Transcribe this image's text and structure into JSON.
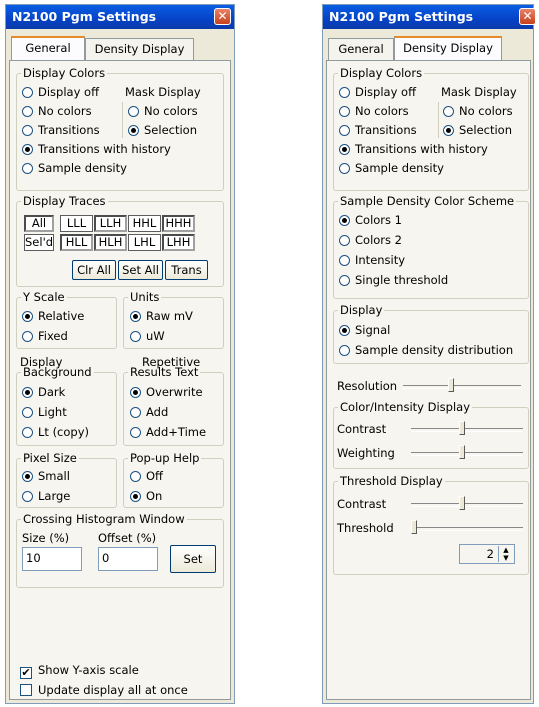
{
  "left": {
    "title": "N2100 Pgm Settings",
    "close_glyph": "✕",
    "tabs": [
      "General",
      "Density Display"
    ],
    "display_colors": {
      "legend": "Display Colors",
      "options": [
        "Display off",
        "No colors",
        "Transitions",
        "Transitions with history",
        "Sample density"
      ],
      "selected": "Transitions with history",
      "mask_legend": "Mask Display",
      "mask_options": [
        "No colors",
        "Selection"
      ],
      "mask_selected": "Selection"
    },
    "display_traces": {
      "legend": "Display Traces",
      "all_button": "All",
      "seld_button": "Sel'd",
      "row1": [
        "LLL",
        "LLH",
        "HHL",
        "HHH"
      ],
      "row2": [
        "HLL",
        "HLH",
        "LHL",
        "LHH"
      ],
      "clr_all": "Clr All",
      "set_all": "Set All",
      "trans": "Trans"
    },
    "y_scale": {
      "legend": "Y Scale",
      "options": [
        "Relative",
        "Fixed"
      ],
      "selected": "Relative"
    },
    "units": {
      "legend": "Units",
      "options": [
        "Raw mV",
        "uW"
      ],
      "selected": "Raw mV"
    },
    "display_background": {
      "heading_1": "Display",
      "heading_2": "Background",
      "options": [
        "Dark",
        "Light",
        "Lt (copy)"
      ],
      "selected": "Dark"
    },
    "repetitive_results": {
      "heading_1": "Repetitive",
      "heading_2": "Results Text",
      "options": [
        "Overwrite",
        "Add",
        "Add+Time"
      ],
      "selected": "Overwrite"
    },
    "pixel_size": {
      "legend": "Pixel Size",
      "options": [
        "Small",
        "Large"
      ],
      "selected": "Small"
    },
    "popup_help": {
      "legend": "Pop-up Help",
      "options": [
        "Off",
        "On"
      ],
      "selected": "On"
    },
    "crossing_histogram": {
      "legend": "Crossing Histogram Window",
      "size_label": "Size (%)",
      "offset_label": "Offset (%)",
      "size_value": "10",
      "offset_value": "0",
      "set_button": "Set"
    },
    "show_y_axis": {
      "label": "Show Y-axis scale",
      "checked": true
    },
    "update_all": {
      "label": "Update display all at once",
      "checked": false
    }
  },
  "right": {
    "title": "N2100 Pgm Settings",
    "close_glyph": "✕",
    "tabs": [
      "General",
      "Density Display"
    ],
    "display_colors": {
      "legend": "Display Colors",
      "options": [
        "Display off",
        "No colors",
        "Transitions",
        "Transitions with history",
        "Sample density"
      ],
      "selected": "Transitions with history",
      "mask_legend": "Mask Display",
      "mask_options": [
        "No colors",
        "Selection"
      ],
      "mask_selected": "Selection"
    },
    "color_scheme": {
      "legend": "Sample Density Color Scheme",
      "options": [
        "Colors 1",
        "Colors 2",
        "Intensity",
        "Single threshold"
      ],
      "selected": "Colors 1"
    },
    "display": {
      "legend": "Display",
      "options": [
        "Signal",
        "Sample density distribution"
      ],
      "selected": "Signal"
    },
    "resolution": {
      "label": "Resolution",
      "level": 0.4
    },
    "color_intensity": {
      "legend": "Color/Intensity Display",
      "contrast_label": "Contrast",
      "contrast_level": 0.45,
      "weighting_label": "Weighting",
      "weighting_level": 0.45
    },
    "threshold_display": {
      "legend": "Threshold Display",
      "contrast_label": "Contrast",
      "contrast_level": 0.45,
      "threshold_label": "Threshold",
      "threshold_level": 0.0,
      "spin_value": "2"
    }
  }
}
